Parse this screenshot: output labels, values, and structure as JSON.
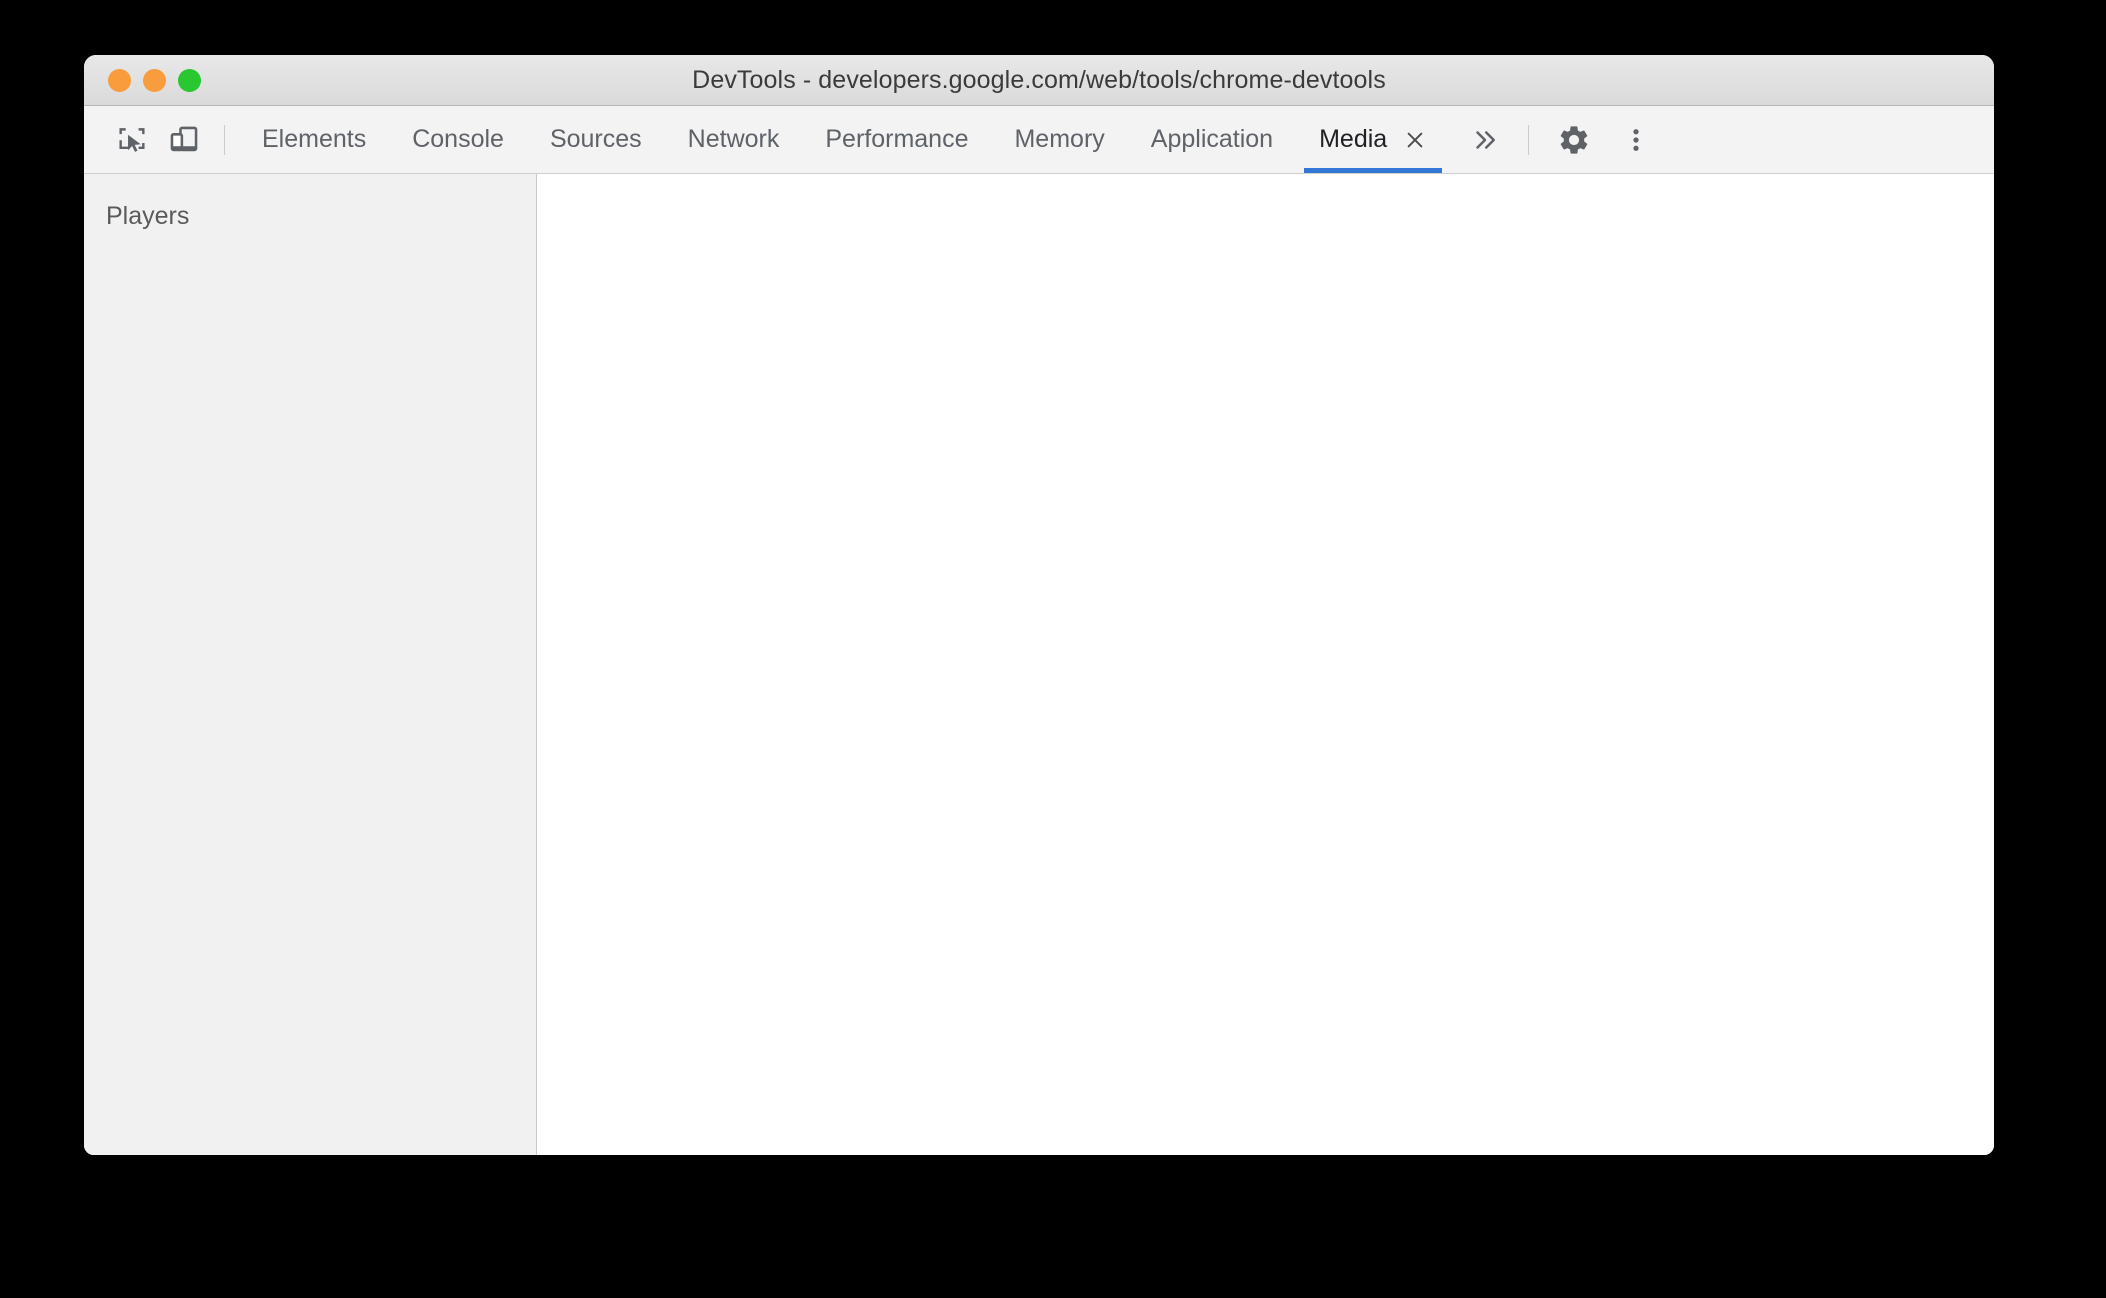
{
  "window": {
    "title": "DevTools - developers.google.com/web/tools/chrome-devtools",
    "traffic_lights": [
      {
        "name": "close",
        "color": "#f89c3d"
      },
      {
        "name": "minimize",
        "color": "#f89c3d"
      },
      {
        "name": "maximize",
        "color": "#29c730"
      }
    ]
  },
  "toolbar": {
    "inspect_icon": "inspect-element-icon",
    "device_toolbar_icon": "device-toolbar-icon",
    "more_panels_icon": "chevron-double-right-icon",
    "settings_icon": "gear-icon",
    "main_menu_icon": "kebab-menu-icon",
    "active_tab_accent": "#3276d6",
    "tabs": [
      {
        "label": "Elements",
        "active": false
      },
      {
        "label": "Console",
        "active": false
      },
      {
        "label": "Sources",
        "active": false
      },
      {
        "label": "Network",
        "active": false
      },
      {
        "label": "Performance",
        "active": false
      },
      {
        "label": "Memory",
        "active": false
      },
      {
        "label": "Application",
        "active": false
      },
      {
        "label": "Media",
        "active": true,
        "closable": true
      }
    ]
  },
  "sidebar": {
    "header": "Players",
    "items": []
  },
  "main": {
    "content": ""
  }
}
